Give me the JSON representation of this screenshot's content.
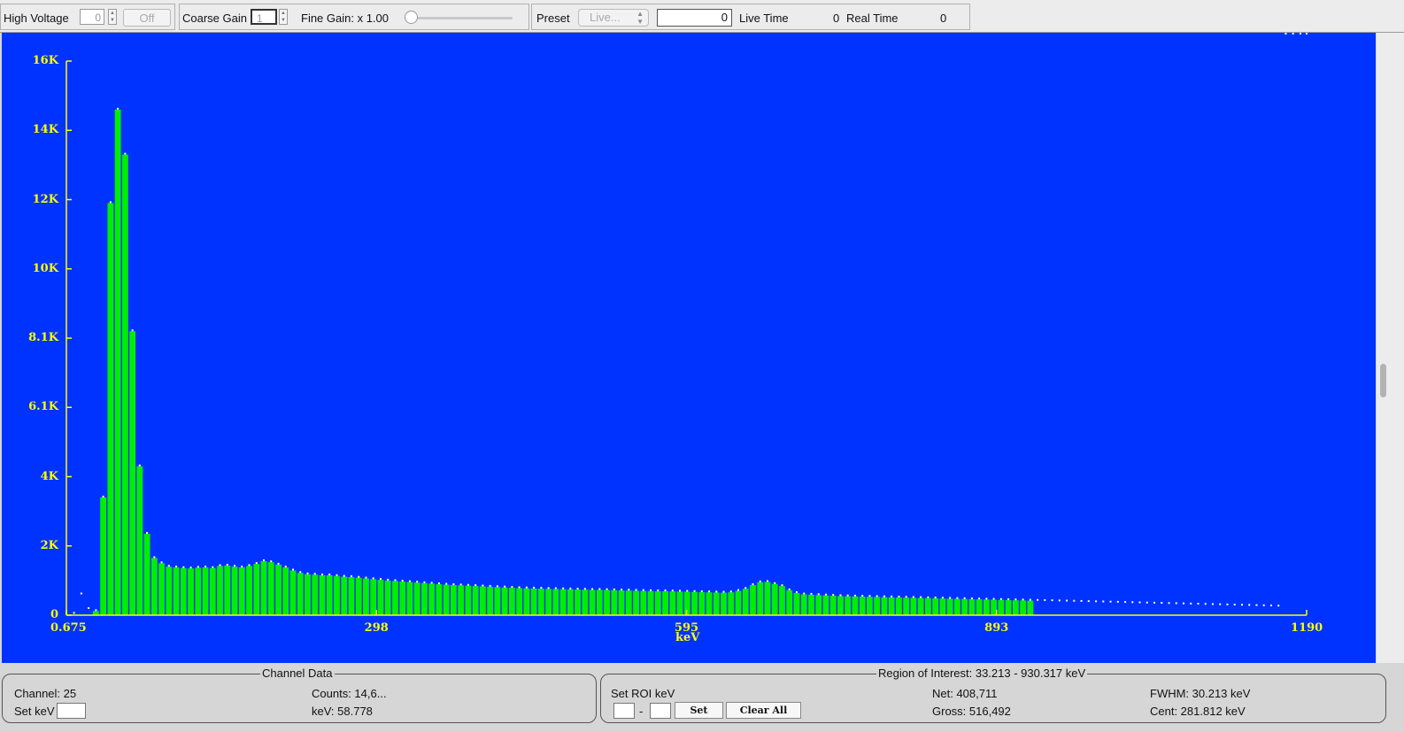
{
  "toolbar": {
    "high_voltage_label": "High Voltage",
    "high_voltage_value": "0",
    "off_label": "Off",
    "coarse_gain_label": "Coarse Gain",
    "coarse_gain_value": "1",
    "fine_gain_label": "Fine Gain: x 1.00",
    "preset_label": "Preset",
    "preset_selected": "Live...",
    "preset_value": "0",
    "live_time_label": "Live Time",
    "live_time_value": "0",
    "real_time_label": "Real Time",
    "real_time_value": "0"
  },
  "chart_data": {
    "type": "bar",
    "xlabel": "keV",
    "ylabel": "",
    "xlim": [
      0.675,
      1190
    ],
    "ylim": [
      0,
      16000
    ],
    "x_ticks": [
      "0.675",
      "298",
      "595",
      "893",
      "1190"
    ],
    "y_ticks": [
      "0",
      "2K",
      "4K",
      "6.1K",
      "8.1K",
      "10K",
      "12K",
      "14K",
      "16K"
    ],
    "colors": {
      "background": "#0033ff",
      "bars": "#00ee00",
      "points": "#ffffff",
      "axis": "#ffff00"
    },
    "roi_end_kev": 930.317,
    "x": [
      0.7,
      8,
      15,
      22,
      29,
      36,
      43,
      50,
      57,
      64,
      71,
      78,
      85,
      92,
      99,
      106,
      113,
      120,
      127,
      134,
      141,
      148,
      155,
      162,
      169,
      176,
      183,
      190,
      197,
      204,
      211,
      218,
      225,
      232,
      239,
      246,
      253,
      260,
      267,
      274,
      281,
      288,
      295,
      302,
      309,
      316,
      323,
      330,
      337,
      344,
      351,
      358,
      365,
      372,
      379,
      386,
      393,
      400,
      407,
      414,
      421,
      428,
      435,
      442,
      449,
      456,
      463,
      470,
      477,
      484,
      491,
      498,
      505,
      512,
      519,
      526,
      533,
      540,
      547,
      554,
      561,
      568,
      575,
      582,
      589,
      596,
      603,
      610,
      617,
      624,
      631,
      638,
      645,
      652,
      659,
      666,
      673,
      680,
      687,
      694,
      701,
      708,
      715,
      722,
      729,
      736,
      743,
      750,
      757,
      764,
      771,
      778,
      785,
      792,
      799,
      806,
      813,
      820,
      827,
      834,
      841,
      848,
      855,
      862,
      869,
      876,
      883,
      890,
      897,
      904,
      911,
      918,
      925,
      932,
      939,
      946,
      953,
      960,
      967,
      974,
      981,
      988,
      995,
      1002,
      1009,
      1016,
      1023,
      1030,
      1037,
      1044,
      1051,
      1058,
      1065,
      1072,
      1079,
      1086,
      1093,
      1100,
      1107,
      1114,
      1121,
      1128,
      1135,
      1142,
      1149,
      1156,
      1163,
      1170,
      1177,
      1184,
      1190
    ],
    "values": [
      30,
      40,
      600,
      180,
      120,
      3400,
      11900,
      14600,
      13300,
      8200,
      4300,
      2350,
      1650,
      1500,
      1400,
      1380,
      1360,
      1350,
      1370,
      1380,
      1360,
      1420,
      1430,
      1400,
      1380,
      1420,
      1480,
      1560,
      1530,
      1460,
      1380,
      1290,
      1220,
      1180,
      1170,
      1150,
      1150,
      1130,
      1110,
      1100,
      1080,
      1060,
      1040,
      1020,
      1000,
      985,
      970,
      955,
      940,
      925,
      910,
      895,
      880,
      870,
      860,
      850,
      840,
      830,
      820,
      810,
      800,
      790,
      780,
      775,
      770,
      765,
      760,
      755,
      750,
      745,
      740,
      735,
      730,
      730,
      725,
      720,
      715,
      710,
      705,
      700,
      695,
      690,
      690,
      685,
      680,
      675,
      670,
      665,
      660,
      655,
      650,
      660,
      700,
      760,
      870,
      950,
      960,
      900,
      840,
      720,
      640,
      600,
      590,
      580,
      570,
      560,
      550,
      545,
      540,
      535,
      530,
      525,
      520,
      515,
      510,
      505,
      500,
      495,
      490,
      485,
      480,
      475,
      470,
      465,
      460,
      455,
      450,
      445,
      440,
      435,
      430,
      425,
      420,
      415,
      410,
      405,
      400,
      395,
      390,
      385,
      380,
      375,
      370,
      365,
      360,
      355,
      350,
      345,
      340,
      335,
      330,
      325,
      320,
      315,
      310,
      305,
      300,
      295,
      290,
      285,
      280,
      275,
      270,
      265,
      260,
      255,
      250
    ]
  },
  "channel_data": {
    "title": "Channel Data",
    "channel": "Channel: 25",
    "set_kev_label": "Set keV",
    "counts": "Counts:  14,6...",
    "kev": "keV:  58.778"
  },
  "roi": {
    "title": "Region of Interest: 33.213 - 930.317 keV",
    "set_roi_label": "Set ROI keV",
    "dash": "-",
    "set_button": "Set",
    "clear_all_button": "Clear All",
    "net": "Net: 408,711",
    "gross": "Gross: 516,492",
    "fwhm": "FWHM: 30.213 keV",
    "cent": "Cent: 281.812 keV"
  }
}
